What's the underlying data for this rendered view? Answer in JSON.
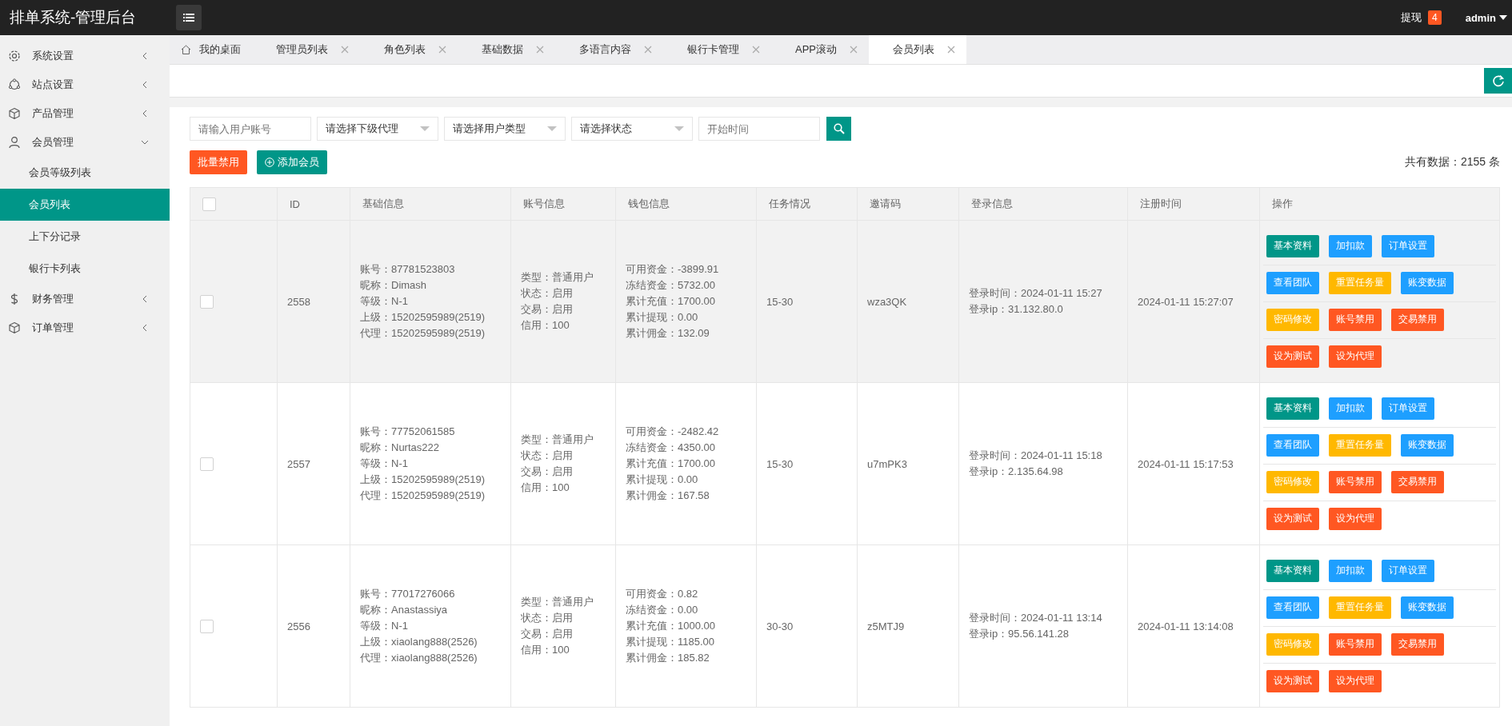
{
  "header": {
    "title": "排单系统-管理后台",
    "withdraw_label": "提现",
    "withdraw_count": "4",
    "user": "admin"
  },
  "sidebar": {
    "items": [
      {
        "label": "系统设置",
        "expanded": false,
        "selected": false
      },
      {
        "label": "站点设置",
        "expanded": false,
        "selected": false
      },
      {
        "label": "产品管理",
        "expanded": false,
        "selected": false
      },
      {
        "label": "会员管理",
        "expanded": true,
        "selected": false,
        "children": [
          {
            "label": "会员等级列表",
            "selected": false
          },
          {
            "label": "会员列表",
            "selected": true
          },
          {
            "label": "上下分记录",
            "selected": false
          },
          {
            "label": "银行卡列表",
            "selected": false
          }
        ]
      },
      {
        "label": "财务管理",
        "expanded": false,
        "selected": false
      },
      {
        "label": "订单管理",
        "expanded": false,
        "selected": false
      }
    ]
  },
  "tabs": [
    {
      "label": "我的桌面",
      "kind": "home",
      "selected": false
    },
    {
      "label": "管理员列表",
      "kind": "page",
      "selected": false
    },
    {
      "label": "角色列表",
      "kind": "page",
      "selected": false
    },
    {
      "label": "基础数据",
      "kind": "page",
      "selected": false
    },
    {
      "label": "多语言内容",
      "kind": "page",
      "selected": false
    },
    {
      "label": "银行卡管理",
      "kind": "page",
      "selected": false
    },
    {
      "label": "APP滚动",
      "kind": "page",
      "selected": false
    },
    {
      "label": "会员列表",
      "kind": "page",
      "selected": true
    }
  ],
  "filters": [
    {
      "kind": "input",
      "placeholder": "请输入用户账号"
    },
    {
      "kind": "select",
      "placeholder": "请选择下级代理"
    },
    {
      "kind": "select",
      "placeholder": "请选择用户类型"
    },
    {
      "kind": "select",
      "placeholder": "请选择状态"
    },
    {
      "kind": "input",
      "placeholder": "开始时间"
    }
  ],
  "toolbar": {
    "buttons": [
      {
        "label": "批量禁用",
        "kind": "danger",
        "plus": false
      },
      {
        "label": "添加会员",
        "kind": "primary",
        "plus": true
      }
    ],
    "total": "共有数据：2155 条"
  },
  "table": {
    "all_checked": false,
    "columns": [
      "ID",
      "基础信息",
      "账号信息",
      "钱包信息",
      "任务情况",
      "邀请码",
      "登录信息",
      "注册时间",
      "操作"
    ],
    "rows": [
      {
        "checked": false,
        "highlighted": true,
        "id": "2558",
        "basic": [
          "账号：87781523803",
          "昵称：Dimash",
          "等级：N-1",
          "上级：15202595989(2519)",
          "代理：15202595989(2519)"
        ],
        "account": [
          "类型：普通用户",
          "状态：启用",
          "交易：启用",
          "信用：100"
        ],
        "wallet": [
          "可用资金：-3899.91",
          "冻结资金：5732.00",
          "累计充值：1700.00",
          "累计提现：0.00",
          "累计佣金：132.09"
        ],
        "task": "15-30",
        "invite": "wza3QK",
        "login": [
          "登录时间：2024-01-11 15:27",
          "登录ip：31.132.80.0"
        ],
        "registered": "2024-01-11 15:27:07",
        "actions": [
          [
            {
              "label": "基本资料",
              "kind": "primary"
            },
            {
              "label": "加扣款",
              "kind": "normal"
            },
            {
              "label": "订单设置",
              "kind": "normal"
            }
          ],
          [
            {
              "label": "查看团队",
              "kind": "normal"
            },
            {
              "label": "重置任务量",
              "kind": "warm"
            },
            {
              "label": "账变数据",
              "kind": "normal"
            }
          ],
          [
            {
              "label": "密码修改",
              "kind": "warm"
            },
            {
              "label": "账号禁用",
              "kind": "danger"
            },
            {
              "label": "交易禁用",
              "kind": "danger"
            }
          ],
          [
            {
              "label": "设为测试",
              "kind": "danger"
            },
            {
              "label": "设为代理",
              "kind": "danger"
            }
          ]
        ]
      },
      {
        "checked": false,
        "highlighted": false,
        "id": "2557",
        "basic": [
          "账号：77752061585",
          "昵称：Nurtas222",
          "等级：N-1",
          "上级：15202595989(2519)",
          "代理：15202595989(2519)"
        ],
        "account": [
          "类型：普通用户",
          "状态：启用",
          "交易：启用",
          "信用：100"
        ],
        "wallet": [
          "可用资金：-2482.42",
          "冻结资金：4350.00",
          "累计充值：1700.00",
          "累计提现：0.00",
          "累计佣金：167.58"
        ],
        "task": "15-30",
        "invite": "u7mPK3",
        "login": [
          "登录时间：2024-01-11 15:18",
          "登录ip：2.135.64.98"
        ],
        "registered": "2024-01-11 15:17:53",
        "actions": [
          [
            {
              "label": "基本资料",
              "kind": "primary"
            },
            {
              "label": "加扣款",
              "kind": "normal"
            },
            {
              "label": "订单设置",
              "kind": "normal"
            }
          ],
          [
            {
              "label": "查看团队",
              "kind": "normal"
            },
            {
              "label": "重置任务量",
              "kind": "warm"
            },
            {
              "label": "账变数据",
              "kind": "normal"
            }
          ],
          [
            {
              "label": "密码修改",
              "kind": "warm"
            },
            {
              "label": "账号禁用",
              "kind": "danger"
            },
            {
              "label": "交易禁用",
              "kind": "danger"
            }
          ],
          [
            {
              "label": "设为测试",
              "kind": "danger"
            },
            {
              "label": "设为代理",
              "kind": "danger"
            }
          ]
        ]
      },
      {
        "checked": false,
        "highlighted": false,
        "id": "2556",
        "basic": [
          "账号：77017276066",
          "昵称：Anastassiya",
          "等级：N-1",
          "上级：xiaolang888(2526)",
          "代理：xiaolang888(2526)"
        ],
        "account": [
          "类型：普通用户",
          "状态：启用",
          "交易：启用",
          "信用：100"
        ],
        "wallet": [
          "可用资金：0.82",
          "冻结资金：0.00",
          "累计充值：1000.00",
          "累计提现：1185.00",
          "累计佣金：185.82"
        ],
        "task": "30-30",
        "invite": "z5MTJ9",
        "login": [
          "登录时间：2024-01-11 13:14",
          "登录ip：95.56.141.28"
        ],
        "registered": "2024-01-11 13:14:08",
        "actions": [
          [
            {
              "label": "基本资料",
              "kind": "primary"
            },
            {
              "label": "加扣款",
              "kind": "normal"
            },
            {
              "label": "订单设置",
              "kind": "normal"
            }
          ],
          [
            {
              "label": "查看团队",
              "kind": "normal"
            },
            {
              "label": "重置任务量",
              "kind": "warm"
            },
            {
              "label": "账变数据",
              "kind": "normal"
            }
          ],
          [
            {
              "label": "密码修改",
              "kind": "warm"
            },
            {
              "label": "账号禁用",
              "kind": "danger"
            },
            {
              "label": "交易禁用",
              "kind": "danger"
            }
          ],
          [
            {
              "label": "设为测试",
              "kind": "danger"
            },
            {
              "label": "设为代理",
              "kind": "danger"
            }
          ]
        ]
      }
    ]
  }
}
